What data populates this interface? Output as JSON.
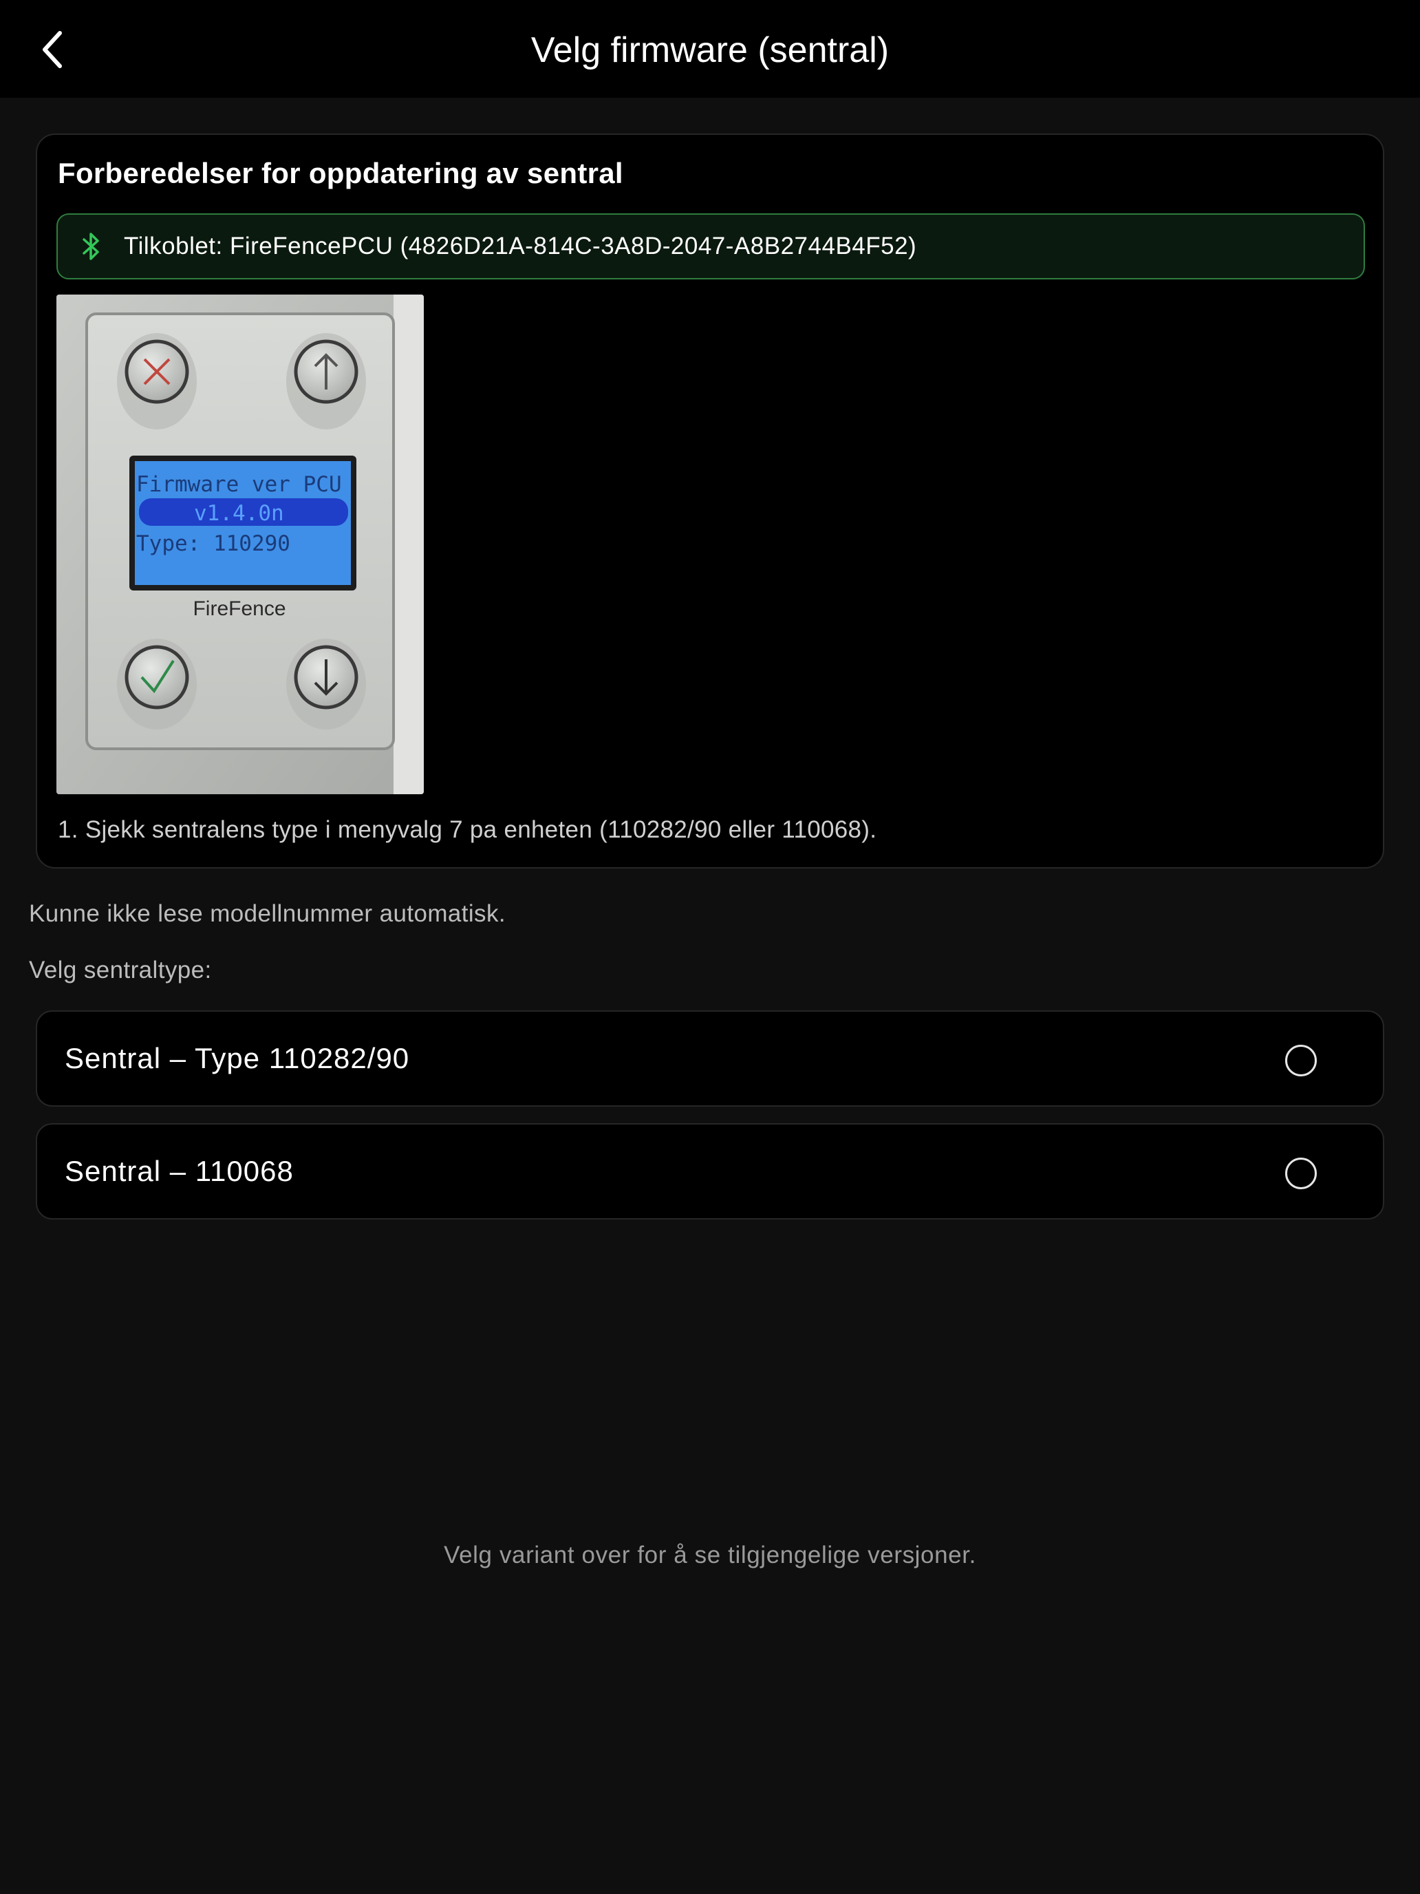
{
  "header": {
    "title": "Velg firmware (sentral)",
    "back_icon": "chevron-left-icon"
  },
  "prep_card": {
    "title": "Forberedelser for oppdatering av sentral",
    "connection": {
      "icon": "bluetooth-icon",
      "text": "Tilkoblet: FireFencePCU (4826D21A-814C-3A8D-2047-A8B2744B4F52)",
      "accent_color": "#34c759"
    },
    "device_display": {
      "line1": "Firmware ver PCU",
      "line2": "v1.4.0n",
      "line3": "Type: 110290",
      "brand": "FireFence"
    },
    "step_text": "1. Sjekk sentralens type i menyvalg 7 pa enheten (110282/90 eller 110068)."
  },
  "info_text": "Kunne ikke lese modellnummer automatisk.",
  "select_label": "Velg sentraltype:",
  "options": [
    {
      "label": "Sentral – Type 110282/90",
      "selected": false
    },
    {
      "label": "Sentral – 110068",
      "selected": false
    }
  ],
  "footer_hint": "Velg variant over for å se tilgjengelige versjoner."
}
